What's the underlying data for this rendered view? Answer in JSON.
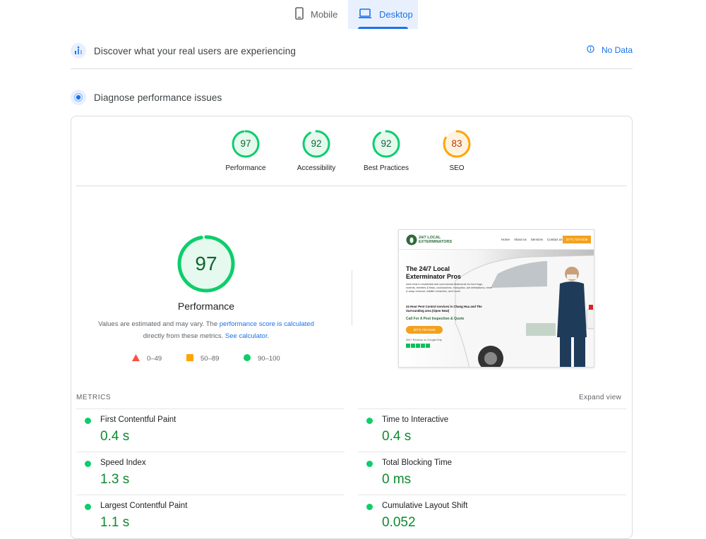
{
  "tabs": [
    {
      "label": "Mobile",
      "icon": "phone-icon",
      "active": false
    },
    {
      "label": "Desktop",
      "icon": "laptop-icon",
      "active": true
    }
  ],
  "field_data": {
    "title": "Discover what your real users are experiencing",
    "status": "No Data"
  },
  "diagnose": {
    "title": "Diagnose performance issues"
  },
  "scores": [
    {
      "label": "Performance",
      "value": 97,
      "color": "#0cce6b",
      "text_color": "#0d652d"
    },
    {
      "label": "Accessibility",
      "value": 92,
      "color": "#0cce6b",
      "text_color": "#0d652d"
    },
    {
      "label": "Best Practices",
      "value": 92,
      "color": "#0cce6b",
      "text_color": "#0d652d"
    },
    {
      "label": "SEO",
      "value": 83,
      "color": "#ffa400",
      "text_color": "#c33300"
    }
  ],
  "performance": {
    "score": "97",
    "label": "Performance",
    "note_prefix": "Values are estimated and may vary. The",
    "note_link": "performance score is calculated",
    "note_mid": "directly from these metrics.",
    "note_link2": "See calculator."
  },
  "legend": [
    {
      "range": "0–49",
      "color": "#ff4e42",
      "shape": "triangle"
    },
    {
      "range": "50–89",
      "color": "#ffa400",
      "shape": "square"
    },
    {
      "range": "90–100",
      "color": "#0cce6b",
      "shape": "circle"
    }
  ],
  "screenshot": {
    "brand": "24/7 LOCAL EXTERMINATORS",
    "nav": [
      "Home",
      "About us",
      "Services",
      "Contact us"
    ],
    "cta": "(877) 730-0438",
    "headline": "The 24/7 Local Exterminator Pros",
    "body": "were best in residential and commercial treatments for bed bugs, rodents, termites & fleas, cockroaches, mosquitos, ant infestations, bees & wasp removal, wildlife extraction, and more!",
    "subhead": "24 Hour Pest Control services in Chang Hua and The Surrounding area (Open Now)",
    "callout": "Call For A Pest Inspection & Quote",
    "button": "(877) 730-0438",
    "reviews": "300+ Reviews on Google/Yelp"
  },
  "metrics": {
    "heading": "METRICS",
    "expand": "Expand view",
    "items": [
      {
        "name": "First Contentful Paint",
        "value": "0.4 s"
      },
      {
        "name": "Time to Interactive",
        "value": "0.4 s"
      },
      {
        "name": "Speed Index",
        "value": "1.3 s"
      },
      {
        "name": "Total Blocking Time",
        "value": "0 ms"
      },
      {
        "name": "Largest Contentful Paint",
        "value": "1.1 s"
      },
      {
        "name": "Cumulative Layout Shift",
        "value": "0.052"
      }
    ]
  }
}
